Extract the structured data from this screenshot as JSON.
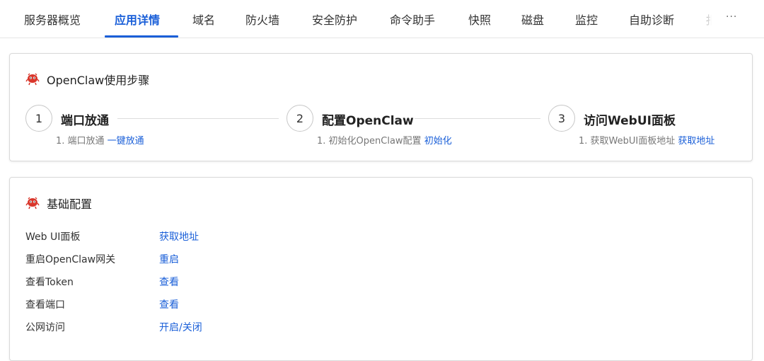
{
  "tabs": [
    {
      "label": "服务器概览",
      "active": false
    },
    {
      "label": "应用详情",
      "active": true
    },
    {
      "label": "域名",
      "active": false
    },
    {
      "label": "防火墙",
      "active": false
    },
    {
      "label": "安全防护",
      "active": false
    },
    {
      "label": "命令助手",
      "active": false
    },
    {
      "label": "快照",
      "active": false
    },
    {
      "label": "磁盘",
      "active": false
    },
    {
      "label": "监控",
      "active": false
    },
    {
      "label": "自助诊断",
      "active": false
    },
    {
      "label": "报",
      "active": false
    }
  ],
  "tab_more": "···",
  "steps_card": {
    "title": "OpenClaw使用步骤",
    "icon": "claw-icon",
    "steps": [
      {
        "number": "1",
        "title": "端口放通",
        "desc_prefix": "1. 端口放通 ",
        "desc_link": "一键放通"
      },
      {
        "number": "2",
        "title": "配置OpenClaw",
        "desc_prefix": "1. 初始化OpenClaw配置 ",
        "desc_link": "初始化"
      },
      {
        "number": "3",
        "title": "访问WebUI面板",
        "desc_prefix": "1. 获取WebUI面板地址 ",
        "desc_link": "获取地址"
      }
    ]
  },
  "config_card": {
    "title": "基础配置",
    "icon": "claw-icon",
    "rows": [
      {
        "label": "Web UI面板",
        "action": "获取地址"
      },
      {
        "label": "重启OpenClaw网关",
        "action": "重启"
      },
      {
        "label": "查看Token",
        "action": "查看"
      },
      {
        "label": "查看端口",
        "action": "查看"
      },
      {
        "label": "公网访问",
        "action": "开启/关闭"
      }
    ]
  },
  "colors": {
    "accent": "#1a5fd8",
    "icon_red": "#d9362b"
  }
}
